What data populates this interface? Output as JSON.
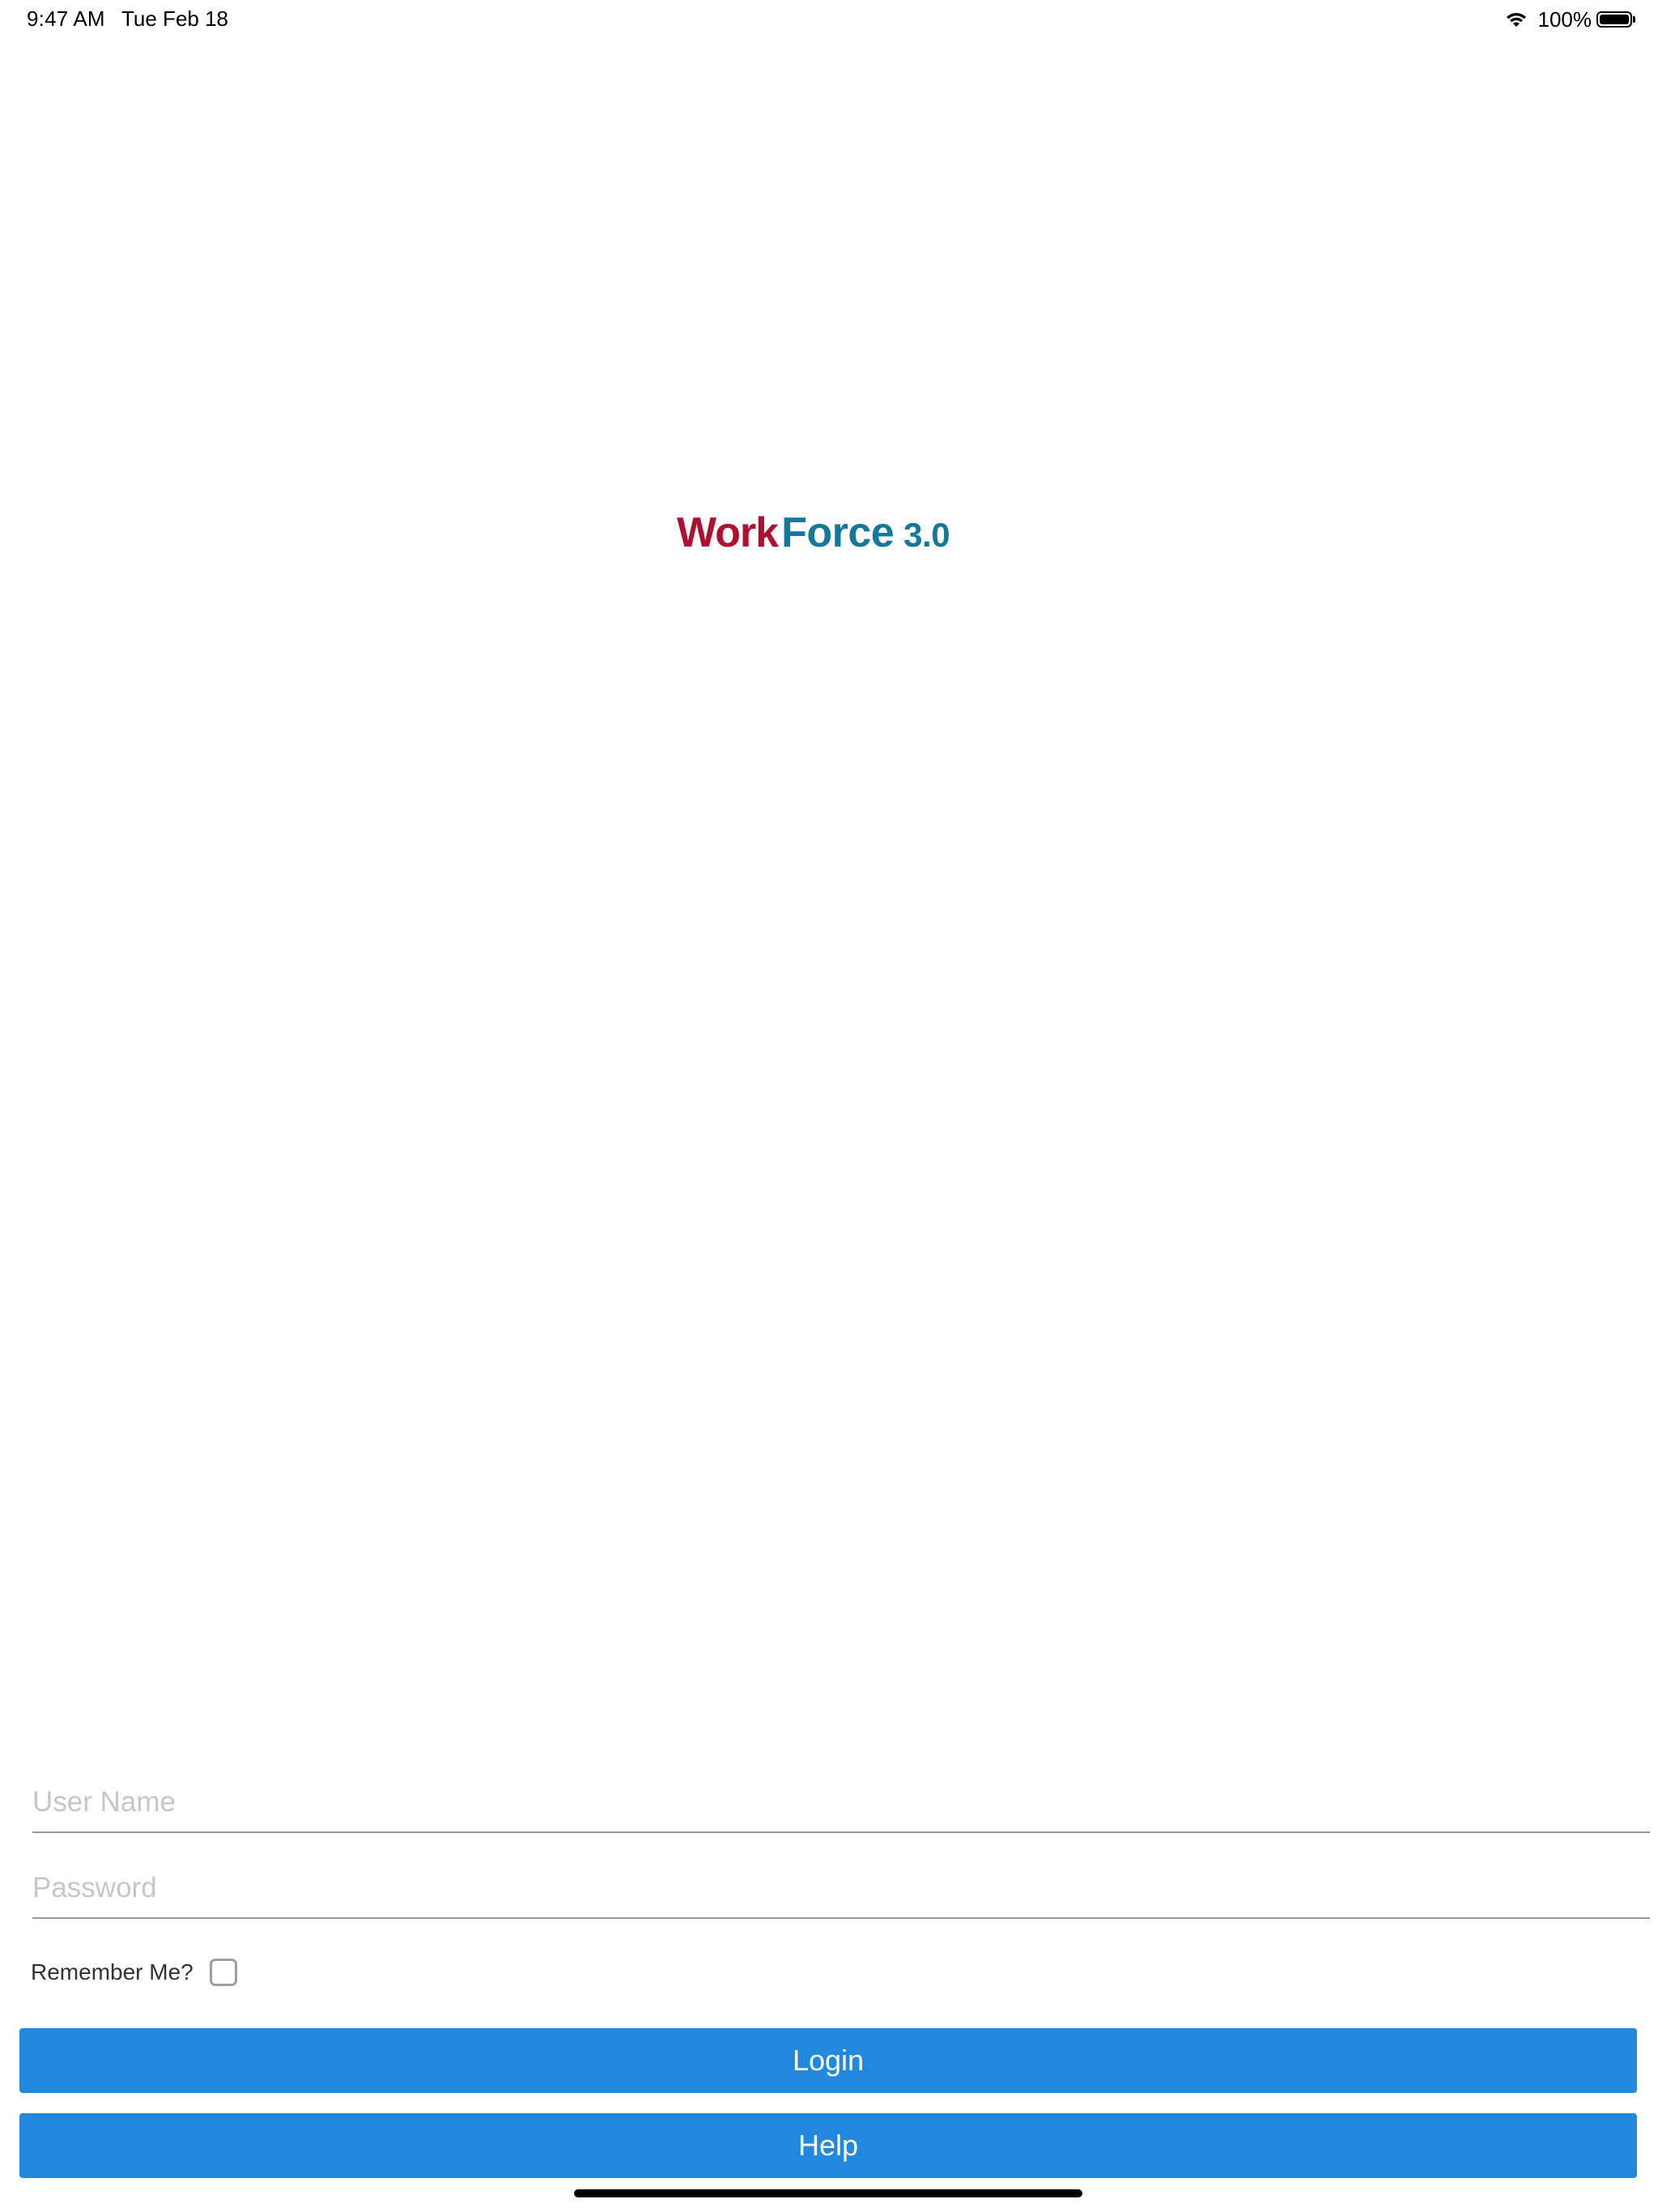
{
  "status_bar": {
    "time": "9:47 AM",
    "date": "Tue Feb 18",
    "battery_percent": "100%",
    "battery_level": 1.0,
    "icons": [
      "wifi-icon",
      "battery-icon"
    ]
  },
  "logo": {
    "part1": "Work",
    "part2": "Force",
    "version": "3.0",
    "colors": {
      "work": "#b0102f",
      "force": "#137899"
    }
  },
  "form": {
    "username_placeholder": "User Name",
    "username_value": "",
    "password_placeholder": "Password",
    "password_value": "",
    "remember_label": "Remember Me?",
    "remember_checked": false
  },
  "buttons": {
    "login_label": "Login",
    "help_label": "Help",
    "color": "#2288dd"
  }
}
